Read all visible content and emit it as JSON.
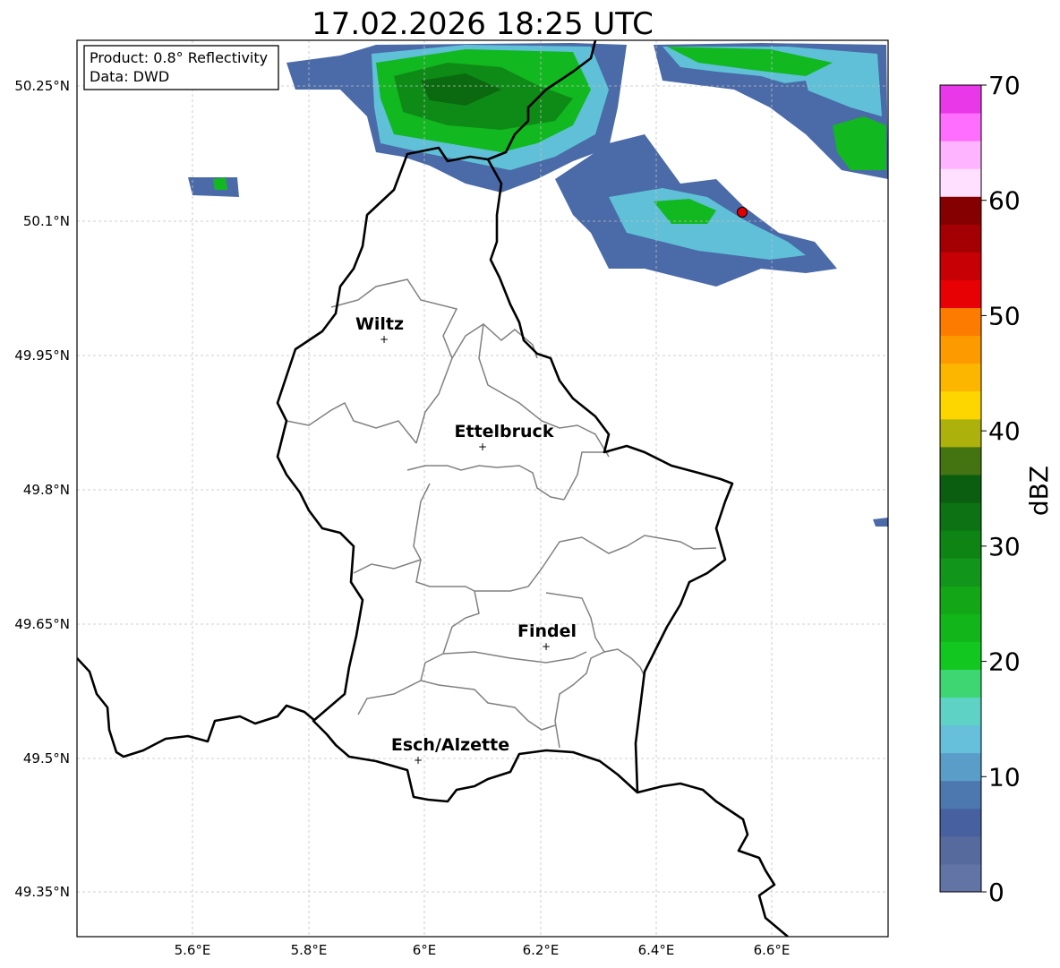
{
  "title": "17.02.2026 18:25 UTC",
  "info_box": {
    "product": "Product: 0.8° Reflectivity",
    "source": "Data: DWD"
  },
  "lat_ticks": [
    "50.25°N",
    "50.1°N",
    "49.95°N",
    "49.8°N",
    "49.65°N",
    "49.5°N",
    "49.35°N"
  ],
  "lon_ticks": [
    "5.6°E",
    "5.8°E",
    "6°E",
    "6.2°E",
    "6.4°E",
    "6.6°E"
  ],
  "cities": [
    {
      "name": "Wiltz"
    },
    {
      "name": "Ettelbruck"
    },
    {
      "name": "Findel"
    },
    {
      "name": "Esch/Alzette"
    }
  ],
  "colorbar": {
    "label": "dBZ",
    "ticks": [
      "0",
      "10",
      "20",
      "30",
      "40",
      "50",
      "60",
      "70"
    ],
    "colors": [
      "#6273a6",
      "#566a9e",
      "#4760a0",
      "#4c78af",
      "#5a9dc8",
      "#66c0db",
      "#5ed3c5",
      "#3dd673",
      "#12c820",
      "#12b51a",
      "#13a616",
      "#11951a",
      "#0d8414",
      "#0c7213",
      "#0b5e0f",
      "#447412",
      "#acb10c",
      "#fdd600",
      "#fdb600",
      "#fd9a00",
      "#fd7c00",
      "#e70004",
      "#c60004",
      "#a40003",
      "#850000",
      "#ffe0ff",
      "#ffb4ff",
      "#ff6eff",
      "#e838e8"
    ]
  },
  "colors": {
    "border": "#000000",
    "cantons": "#808080",
    "grid": "#c0c0c0",
    "radar_site": "#e00000",
    "echo_light": "#4a6aa8",
    "echo_mid": "#5fc0d8",
    "echo_green": "#12b820",
    "echo_dark": "#0e8a16"
  }
}
